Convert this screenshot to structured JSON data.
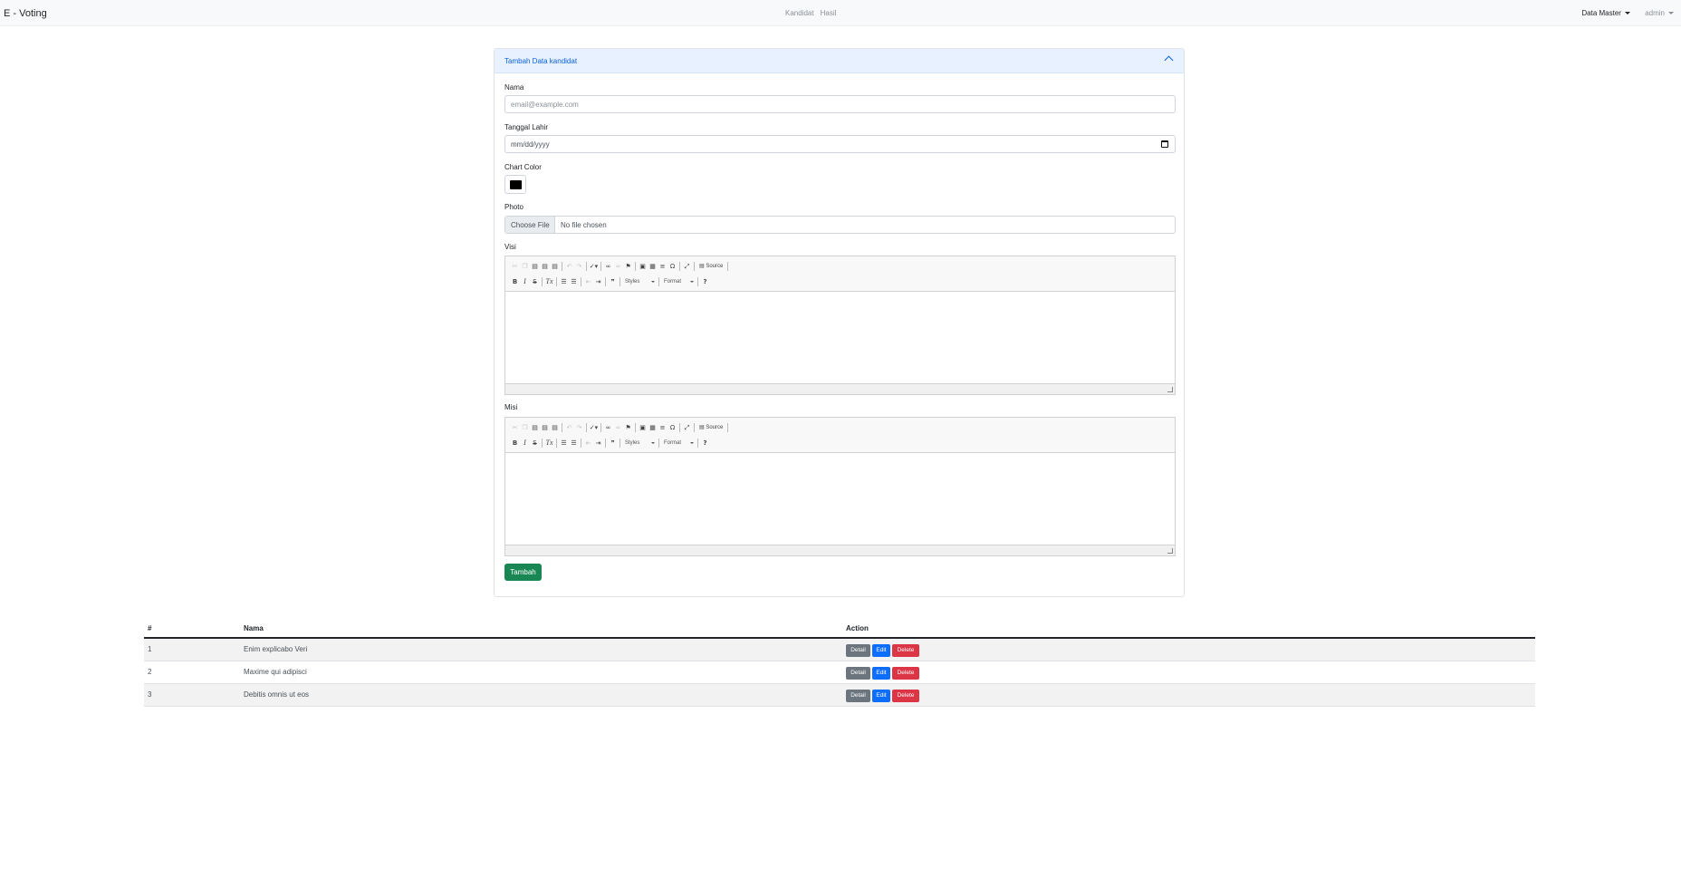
{
  "navbar": {
    "brand": "E - Voting",
    "links": [
      "Kandidat",
      "Hasil"
    ],
    "data_master": "Data Master",
    "user": "admin"
  },
  "form": {
    "title": "Tambah Data kandidat",
    "nama_label": "Nama",
    "nama_placeholder": "email@example.com",
    "tgl_label": "Tanggal Lahir",
    "tgl_placeholder": "mm/dd/yyyy",
    "color_label": "Chart Color",
    "color_value": "#000000",
    "photo_label": "Photo",
    "file_button": "Choose File",
    "file_status": "No file chosen",
    "visi_label": "Visi",
    "misi_label": "Misi",
    "editor": {
      "source_label": "Source",
      "styles_label": "Styles",
      "format_label": "Format"
    },
    "submit": "Tambah"
  },
  "table": {
    "headers": [
      "#",
      "Nama",
      "Action"
    ],
    "rows": [
      {
        "no": "1",
        "nama": "Enim explicabo Veri"
      },
      {
        "no": "2",
        "nama": "Maxime qui adipisci"
      },
      {
        "no": "3",
        "nama": "Debitis omnis ut eos"
      }
    ],
    "actions": {
      "detail": "Detail",
      "edit": "Edit",
      "delete": "Delete"
    }
  }
}
